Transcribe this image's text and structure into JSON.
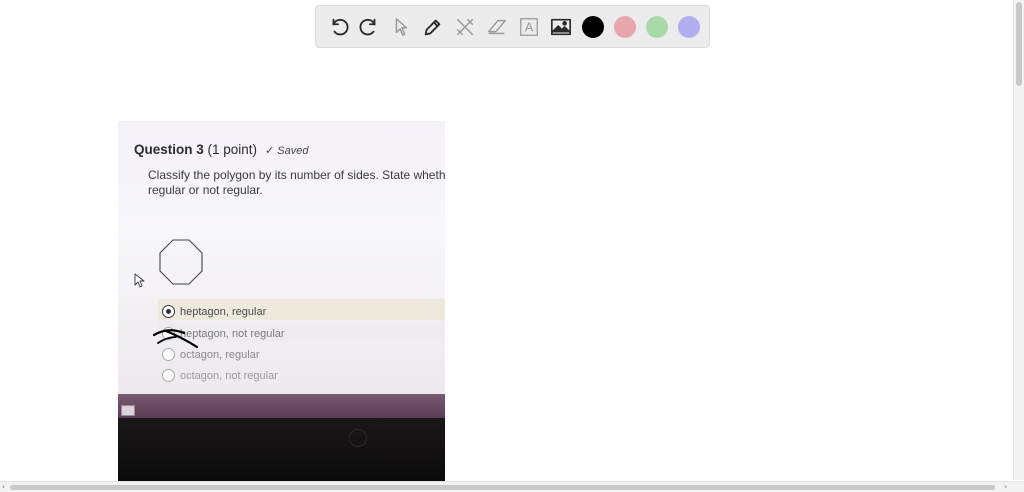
{
  "toolbar": {
    "tools": [
      "undo-icon",
      "redo-icon",
      "pointer-icon",
      "pen-icon",
      "tools-icon",
      "eraser-icon",
      "text-icon",
      "image-icon"
    ],
    "text_tool_glyph": "A",
    "colors": [
      "#000000",
      "#e8a7ad",
      "#a9d8a9",
      "#b3aef0"
    ]
  },
  "question": {
    "title": "Question 3",
    "points": "(1 point)",
    "saved_mark": "✓",
    "saved": "Saved",
    "text": "Classify the polygon by its number of sides. State whether it is regular or not regular.",
    "options": [
      {
        "label": "heptagon, regular",
        "selected": true
      },
      {
        "label": "heptagon, not regular",
        "selected": false
      },
      {
        "label": "octagon, regular",
        "selected": false
      },
      {
        "label": "octagon, not regular",
        "selected": false
      }
    ]
  },
  "scrollbar": {
    "left_arrow": "‹",
    "right_arrow": "›"
  }
}
